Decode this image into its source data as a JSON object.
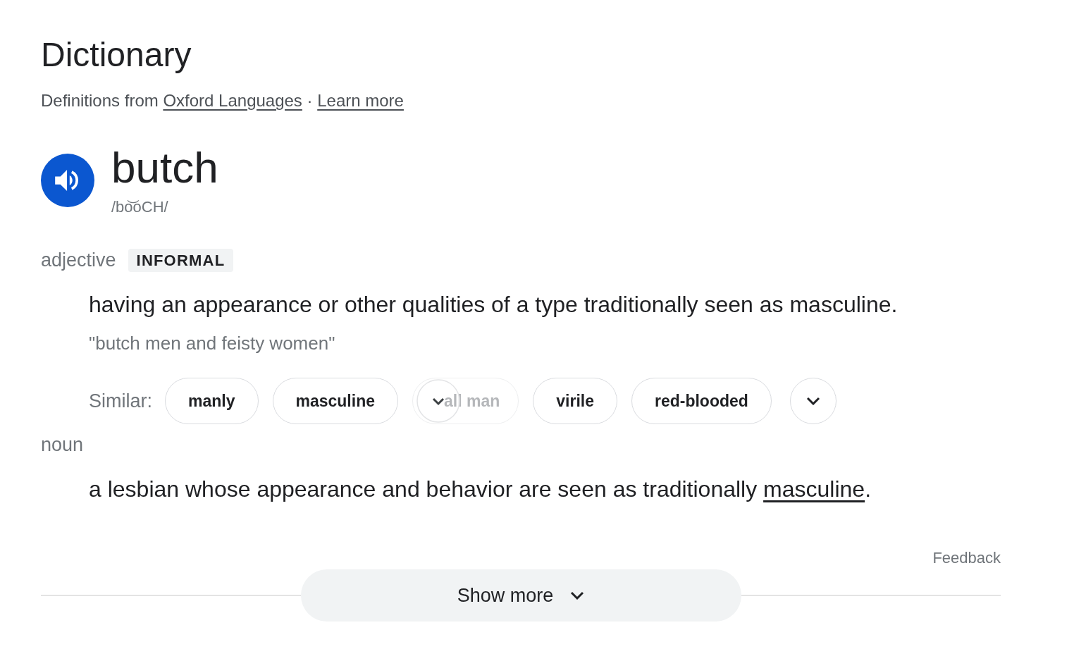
{
  "header": {
    "title": "Dictionary",
    "source": [
      {
        "kind": "text",
        "text": "Definitions from "
      },
      {
        "kind": "link",
        "text": "Oxford Languages"
      },
      {
        "kind": "text",
        "text": " · "
      },
      {
        "kind": "link",
        "text": "Learn more"
      }
    ]
  },
  "entry": {
    "word": "butch",
    "pronunciation": "/bo͝oCH/"
  },
  "senses": [
    {
      "part_of_speech": "adjective",
      "register_tag": "INFORMAL",
      "definition": [
        {
          "kind": "text",
          "text": "having an appearance or other qualities of a type traditionally seen as masculine."
        }
      ],
      "example": "\"butch men and feisty women\"",
      "similar": {
        "label": "Similar:",
        "words": [
          {
            "text": "manly",
            "faded": false
          },
          {
            "text": "masculine",
            "faded": false
          },
          {
            "text": "all man",
            "faded": true
          },
          {
            "text": "virile",
            "faded": false
          },
          {
            "text": "red-blooded",
            "faded": false
          }
        ],
        "expand_button": {
          "expanded": false
        }
      }
    },
    {
      "part_of_speech": "noun",
      "definition": [
        {
          "kind": "text",
          "text": "a lesbian whose appearance and behavior are seen as traditionally "
        },
        {
          "kind": "link",
          "text": "masculine"
        },
        {
          "kind": "text",
          "text": "."
        }
      ]
    }
  ],
  "feedback": "Feedback",
  "show_more": {
    "label": "Show more",
    "expanded": false
  }
}
